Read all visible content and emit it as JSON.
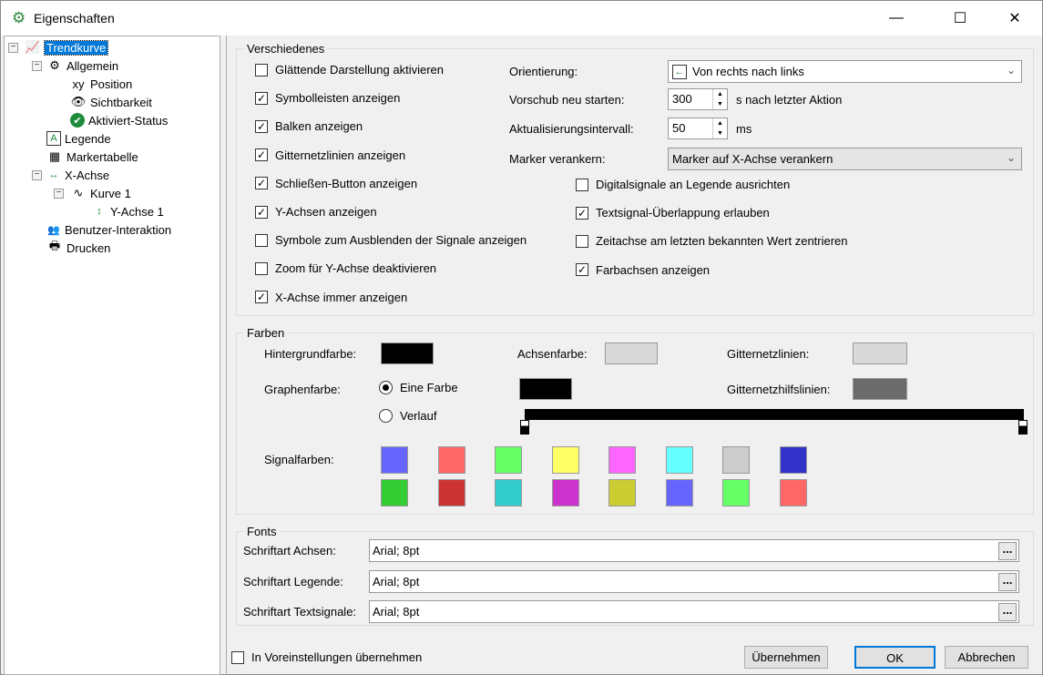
{
  "window": {
    "title": "Eigenschaften",
    "minimize": "—",
    "maximize": "☐",
    "close": "✕"
  },
  "tree": [
    {
      "label": "Trendkurve",
      "icon": "trend-icon"
    },
    {
      "label": "Allgemein",
      "icon": "gear-icon"
    },
    {
      "label": "Position",
      "icon": "xy-icon"
    },
    {
      "label": "Sichtbarkeit",
      "icon": "eye-icon"
    },
    {
      "label": "Aktiviert-Status",
      "icon": "check-circle-icon"
    },
    {
      "label": "Legende",
      "icon": "legend-icon"
    },
    {
      "label": "Markertabelle",
      "icon": "grid-icon"
    },
    {
      "label": "X-Achse",
      "icon": "x-axis-icon"
    },
    {
      "label": "Kurve 1",
      "icon": "wave-icon"
    },
    {
      "label": "Y-Achse 1",
      "icon": "y-axis-icon"
    },
    {
      "label": "Benutzer-Interaktion",
      "icon": "users-icon"
    },
    {
      "label": "Drucken",
      "icon": "printer-icon"
    }
  ],
  "misc": {
    "title": "Verschiedenes",
    "left_checks": [
      {
        "label": "Glättende Darstellung aktivieren",
        "checked": false
      },
      {
        "label": "Symbolleisten anzeigen",
        "checked": true
      },
      {
        "label": "Balken anzeigen",
        "checked": true
      },
      {
        "label": "Gitternetzlinien anzeigen",
        "checked": true
      },
      {
        "label": "Schließen-Button anzeigen",
        "checked": true
      },
      {
        "label": "Y-Achsen anzeigen",
        "checked": true
      },
      {
        "label": "Symbole zum Ausblenden der Signale anzeigen",
        "checked": false
      },
      {
        "label": "Zoom für Y-Achse deaktivieren",
        "checked": false
      },
      {
        "label": "X-Achse immer anzeigen",
        "checked": true
      }
    ],
    "orientation_label": "Orientierung:",
    "orientation_value": "Von rechts nach links",
    "feed_label": "Vorschub neu starten:",
    "feed_value": "300",
    "feed_unit": "s nach letzter Aktion",
    "interval_label": "Aktualisierungsintervall:",
    "interval_value": "50",
    "interval_unit": "ms",
    "marker_label": "Marker verankern:",
    "marker_value": "Marker auf X-Achse verankern",
    "right_checks": [
      {
        "label": "Digitalsignale an Legende ausrichten",
        "checked": false
      },
      {
        "label": "Textsignal-Überlappung erlauben",
        "checked": true
      },
      {
        "label": "Zeitachse am letzten bekannten Wert zentrieren",
        "checked": false
      },
      {
        "label": "Farbachsen anzeigen",
        "checked": true
      }
    ]
  },
  "colors": {
    "title": "Farben",
    "bg_label": "Hintergrundfarbe:",
    "bg": "#000000",
    "axis_label": "Achsenfarbe:",
    "axis": "#d9d9d9",
    "grid_label": "Gitternetzlinien:",
    "grid": "#d9d9d9",
    "graph_label": "Graphenfarbe:",
    "one_color": "Eine Farbe",
    "gradient": "Verlauf",
    "graph": "#000000",
    "mode": "one",
    "subgrid_label": "Gitternetzhilfslinien:",
    "subgrid": "#6b6b6b",
    "signal_label": "Signalfarben:",
    "signals": [
      "#6666ff",
      "#ff6666",
      "#66ff66",
      "#ffff66",
      "#ff66ff",
      "#66ffff",
      "#cccccc",
      "#3333cc",
      "#33cc33",
      "#cc3333",
      "#33cccc",
      "#cc33cc",
      "#cccc33",
      "#6666ff",
      "#66ff66",
      "#ff6666"
    ]
  },
  "fonts": {
    "title": "Fonts",
    "rows": [
      {
        "label": "Schriftart Achsen:",
        "value": "Arial; 8pt"
      },
      {
        "label": "Schriftart Legende:",
        "value": "Arial; 8pt"
      },
      {
        "label": "Schriftart Textsignale:",
        "value": "Arial; 8pt"
      }
    ],
    "browse": "..."
  },
  "footer": {
    "defaults_label": "In Voreinstellungen übernehmen",
    "apply": "Übernehmen",
    "ok": "OK",
    "cancel": "Abbrechen"
  }
}
